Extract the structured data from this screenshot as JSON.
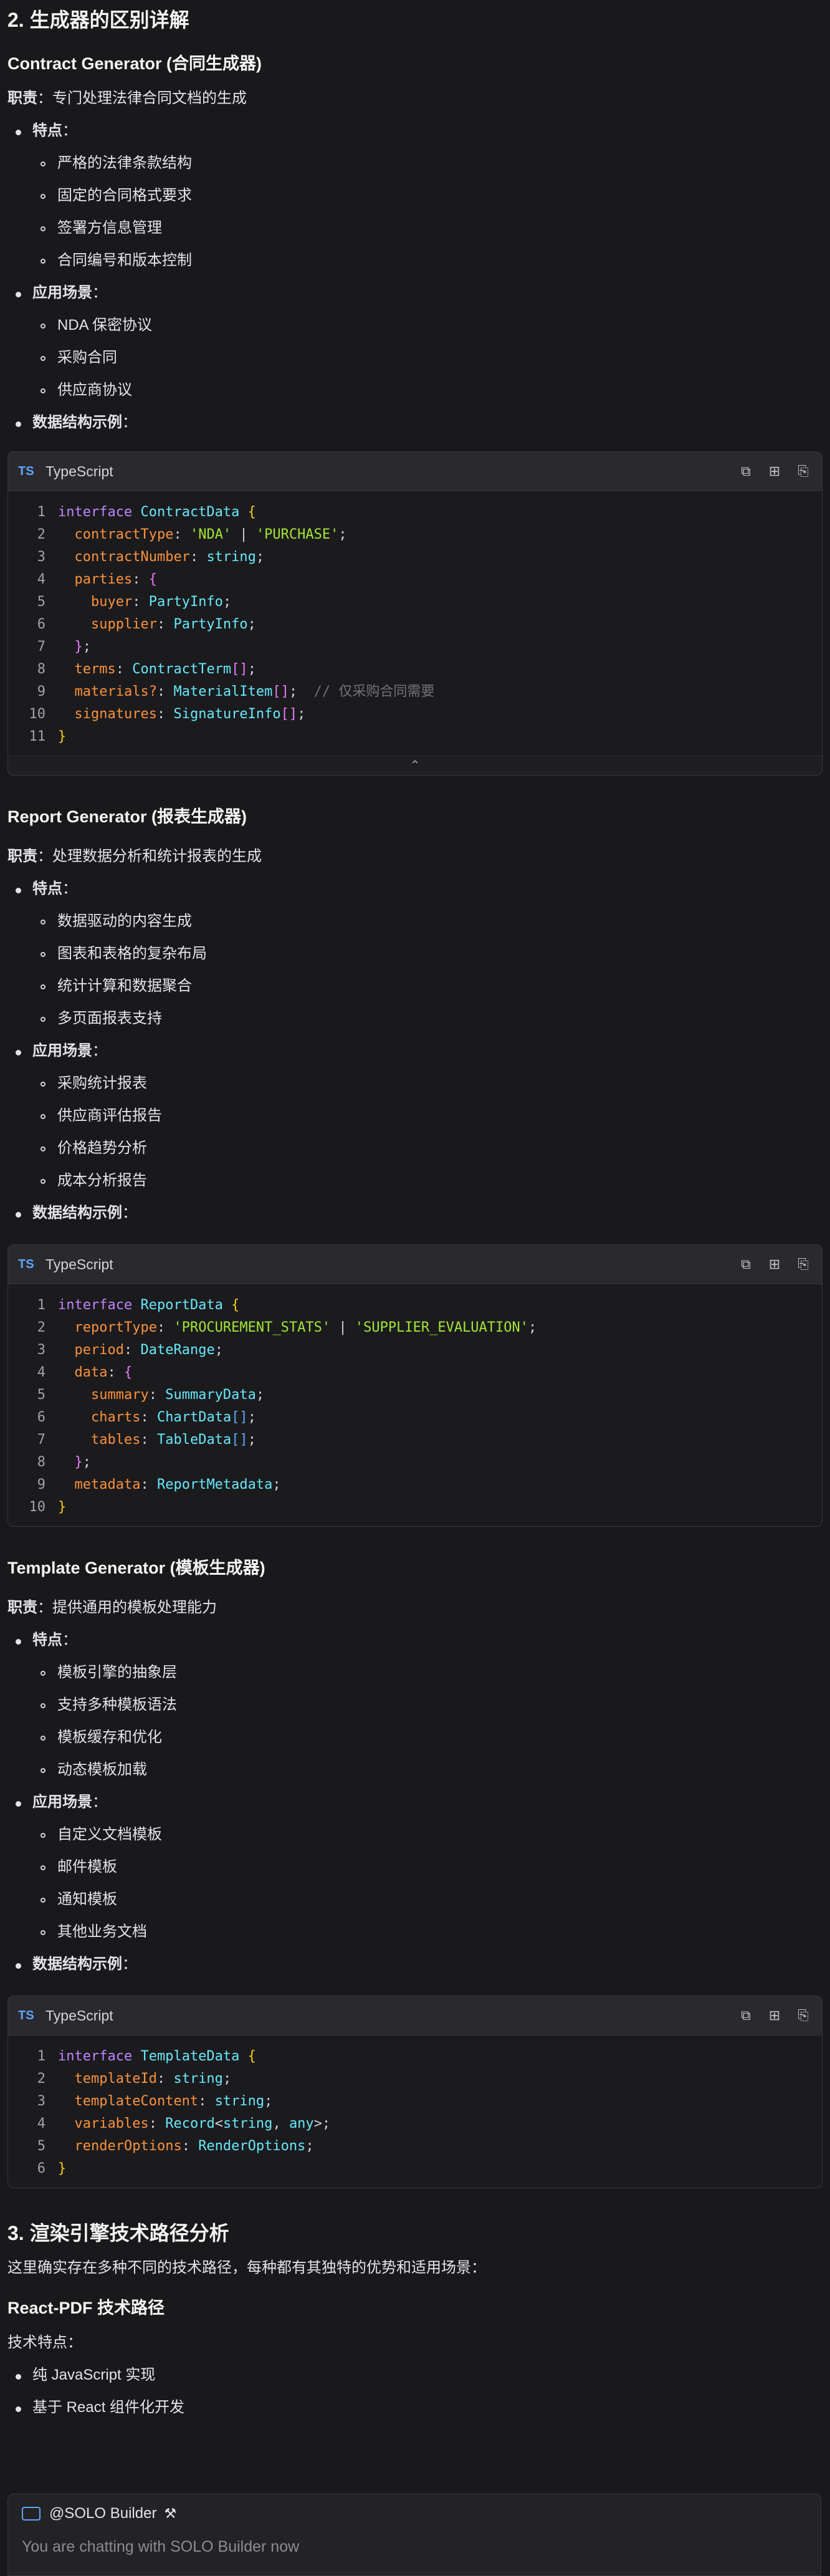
{
  "sections": {
    "s2_title": "2. 生成器的区别详解",
    "s3_title": "3. 渲染引擎技术路径分析",
    "s3_intro": "这里确实存在多种不同的技术路径，每种都有其独特的优势和适用场景："
  },
  "generators": [
    {
      "title": "Contract Generator (合同生成器)",
      "duty_label": "职责",
      "duty": "：专门处理法律合同文档的生成",
      "features_label": "特点",
      "features": [
        "严格的法律条款结构",
        "固定的合同格式要求",
        "签署方信息管理",
        "合同编号和版本控制"
      ],
      "scenarios_label": "应用场景",
      "scenarios": [
        "NDA 保密协议",
        "采购合同",
        "供应商协议"
      ],
      "example_label": "数据结构示例",
      "lang": "TypeScript"
    },
    {
      "title": "Report Generator (报表生成器)",
      "duty_label": "职责",
      "duty": "：处理数据分析和统计报表的生成",
      "features_label": "特点",
      "features": [
        "数据驱动的内容生成",
        "图表和表格的复杂布局",
        "统计计算和数据聚合",
        "多页面报表支持"
      ],
      "scenarios_label": "应用场景",
      "scenarios": [
        "采购统计报表",
        "供应商评估报告",
        "价格趋势分析",
        "成本分析报告"
      ],
      "example_label": "数据结构示例",
      "lang": "TypeScript"
    },
    {
      "title": "Template Generator (模板生成器)",
      "duty_label": "职责",
      "duty": "：提供通用的模板处理能力",
      "features_label": "特点",
      "features": [
        "模板引擎的抽象层",
        "支持多种模板语法",
        "模板缓存和优化",
        "动态模板加载"
      ],
      "scenarios_label": "应用场景",
      "scenarios": [
        "自定义文档模板",
        "邮件模板",
        "通知模板",
        "其他业务文档"
      ],
      "example_label": "数据结构示例",
      "lang": "TypeScript"
    }
  ],
  "react_pdf": {
    "title": "React-PDF 技术路径",
    "label": "技术特点：",
    "items": [
      "纯 JavaScript 实现",
      "基于 React 组件化开发"
    ]
  },
  "code_icons": {
    "lang_badge": "TS",
    "copy": "copy-icon",
    "insert": "insert-icon",
    "apply": "apply-icon"
  },
  "collapse_glyph": "⌃",
  "chat": {
    "agent": "@SOLO Builder",
    "placeholder": "You are chatting with SOLO Builder now"
  }
}
